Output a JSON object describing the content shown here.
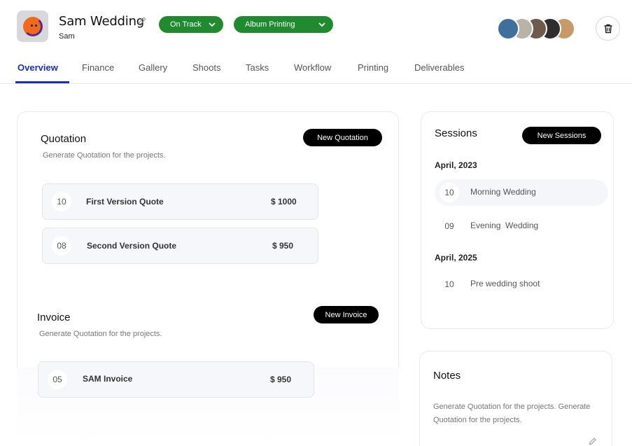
{
  "project": {
    "title": "Sam Wedding",
    "client": "Sam"
  },
  "status_pills": {
    "status": "On Track",
    "album": "Album Printing"
  },
  "avatars": [
    {
      "name": "avatar-1",
      "color": "#3f6f9a"
    },
    {
      "name": "avatar-2",
      "color": "#b9b2a8"
    },
    {
      "name": "avatar-3",
      "color": "#6d5a4c"
    },
    {
      "name": "avatar-4",
      "color": "#2e2e2e"
    },
    {
      "name": "avatar-5",
      "color": "#c89a6a"
    }
  ],
  "tabs": [
    "Overview",
    "Finance",
    "Gallery",
    "Shoots",
    "Tasks",
    "Workflow",
    "Printing",
    "Deliverables"
  ],
  "active_tab": "Overview",
  "quotation": {
    "title": "Quotation",
    "subtitle": "Generate Quotation for the projects.",
    "button": "New Quotation",
    "rows": [
      {
        "num": "10",
        "label": "First Version Quote",
        "amount": "$ 1000"
      },
      {
        "num": "08",
        "label": "Second Version Quote",
        "amount": "$ 950"
      }
    ]
  },
  "invoice": {
    "title": "Invoice",
    "subtitle": "Generate Quotation for the projects.",
    "button": "New Invoice",
    "rows": [
      {
        "num": "05",
        "label": "SAM Invoice",
        "amount": "$ 950"
      }
    ]
  },
  "sessions": {
    "title": "Sessions",
    "button": "New Sessions",
    "groups": [
      {
        "label": "April, 2023",
        "items": [
          {
            "num": "10",
            "name": "Morning Wedding"
          },
          {
            "num": "09",
            "name": "Evening  Wedding"
          }
        ]
      },
      {
        "label": "April, 2025",
        "items": [
          {
            "num": "10",
            "name": "Pre wedding shoot"
          }
        ]
      }
    ]
  },
  "notes": {
    "title": "Notes",
    "text": "Generate Quotation for the projects. Generate Quotation for the projects."
  },
  "colors": {
    "accent": "#1b2fb5",
    "status_green": "#1f8a2e",
    "button_black": "#000000",
    "logo_orange": "#f06a1c"
  }
}
